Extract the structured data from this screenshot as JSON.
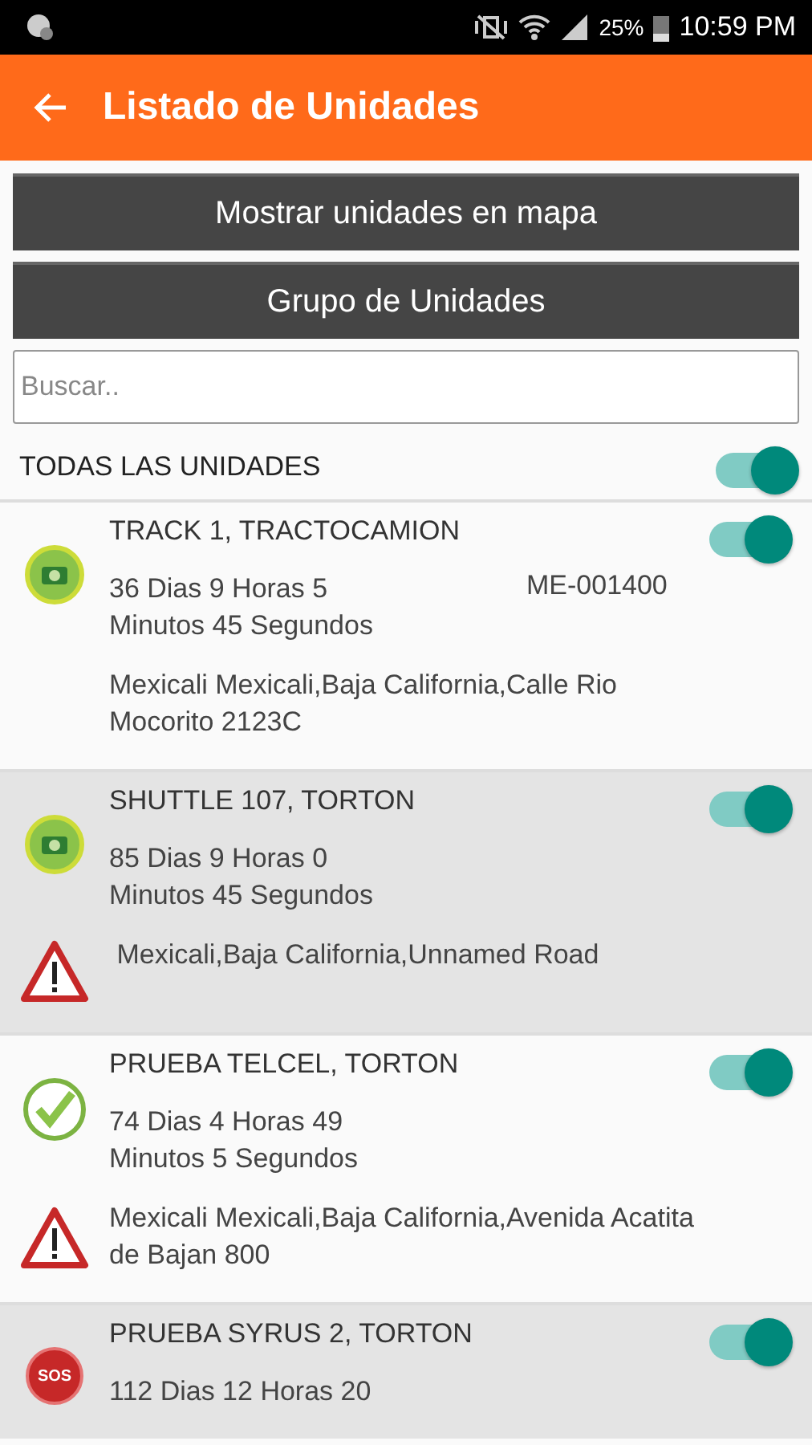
{
  "status_bar": {
    "battery": "25%",
    "time": "10:59 PM"
  },
  "app_bar": {
    "title": "Listado de Unidades"
  },
  "buttons": [
    "Mostrar unidades en mapa",
    "Grupo de Unidades"
  ],
  "search": {
    "placeholder": "Buscar.."
  },
  "all_units": {
    "label": "TODAS LAS UNIDADES",
    "on": true
  },
  "units": [
    {
      "name": "TRACK 1, TRACTOCAMION",
      "kind": "engine",
      "time": [
        "36 Dias 9 Horas 5",
        "Minutos 45 Segundos"
      ],
      "plate": "ME-001400",
      "alert": false,
      "address": [
        "Mexicali Mexicali,Baja California,Calle Rio",
        "Mocorito 2123C"
      ],
      "on": true,
      "shaded": false
    },
    {
      "name": "SHUTTLE 107, TORTON",
      "kind": "engine",
      "time": [
        "85 Dias 9 Horas 0",
        "Minutos 45 Segundos"
      ],
      "alert": true,
      "address": [
        " Mexicali,Baja California,Unnamed Road"
      ],
      "on": true,
      "shaded": true
    },
    {
      "name": "PRUEBA TELCEL, TORTON",
      "kind": "check",
      "time": [
        "74 Dias 4 Horas 49",
        "Minutos 5 Segundos"
      ],
      "alert": true,
      "address": [
        "Mexicali Mexicali,Baja California,Avenida Acatita",
        "de Bajan 800"
      ],
      "on": true,
      "shaded": false
    },
    {
      "name": "PRUEBA SYRUS 2, TORTON",
      "kind": "sos",
      "badge": "SOS",
      "time": [
        "112 Dias 12 Horas 20"
      ],
      "on": true,
      "shaded": true
    }
  ]
}
